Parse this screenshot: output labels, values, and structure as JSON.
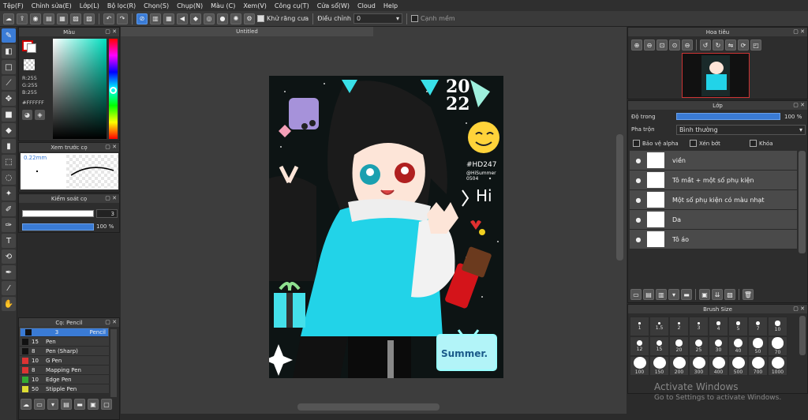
{
  "menu": [
    "Tệp(F)",
    "Chỉnh sửa(E)",
    "Lớp(L)",
    "Bộ lọc(R)",
    "Chọn(S)",
    "Chụp(N)",
    "Màu (C)",
    "Xem(V)",
    "Công cụ(T)",
    "Cửa sổ(W)",
    "Cloud",
    "Help"
  ],
  "toolbar": {
    "antialias_label": "Khử răng cưa",
    "adjust_label": "Điều chỉnh",
    "adjust_value": "0",
    "sharp_label": "Cạnh mềm"
  },
  "color_panel": {
    "title": "Màu",
    "r": "R:255",
    "g": "G:255",
    "b": "B:255",
    "hex": "#FFFFFF"
  },
  "preview_panel": {
    "title": "Xem trước cọ",
    "size": "0.22mm"
  },
  "control_panel": {
    "title": "Kiểm soát cọ",
    "size_value": "3",
    "opacity_value": "100 %"
  },
  "brush_panel": {
    "title": "Cọ: Pencil",
    "items": [
      {
        "size": "3",
        "name": "Pencil",
        "color": "#111111"
      },
      {
        "size": "15",
        "name": "Pen",
        "color": "#111111"
      },
      {
        "size": "8",
        "name": "Pen (Sharp)",
        "color": "#111111"
      },
      {
        "size": "10",
        "name": "G Pen",
        "color": "#dd3333"
      },
      {
        "size": "8",
        "name": "Mapping Pen",
        "color": "#dd3333"
      },
      {
        "size": "10",
        "name": "Edge Pen",
        "color": "#33aa33"
      },
      {
        "size": "50",
        "name": "Stipple Pen",
        "color": "#dddd33"
      }
    ]
  },
  "canvas": {
    "tab_title": "Untitled"
  },
  "artwork_text": {
    "year_top": "20",
    "year_bottom": "22",
    "tag": "#HD247",
    "signature": "@HiSummer 0504",
    "hi": "Hi",
    "sign": "Summer."
  },
  "navigator": {
    "title": "Hoa tiêu"
  },
  "layers": {
    "title": "Lớp",
    "opacity_label": "Độ trong",
    "opacity_value": "100 %",
    "blend_label": "Pha trộn",
    "blend_value": "Bình thường",
    "protect_alpha": "Bảo vệ alpha",
    "clipping": "Xén bớt",
    "lock": "Khóa",
    "items": [
      "viền",
      "Tô mắt + một số phụ kiện",
      "Một số phụ kiện có màu nhạt",
      "Da",
      "Tô áo"
    ]
  },
  "brush_size": {
    "title": "Brush Size",
    "sizes": [
      "1",
      "1.5",
      "2",
      "3",
      "4",
      "5",
      "7",
      "10",
      "12",
      "15",
      "20",
      "25",
      "30",
      "40",
      "50",
      "70",
      "100",
      "150",
      "200",
      "300",
      "400",
      "500",
      "700",
      "1000"
    ]
  },
  "watermark": {
    "line1": "Activate Windows",
    "line2": "Go to Settings to activate Windows."
  }
}
